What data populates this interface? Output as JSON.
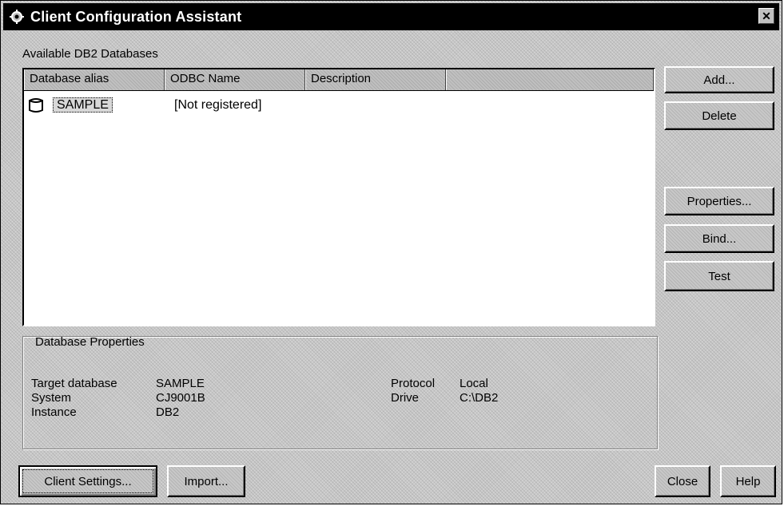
{
  "window": {
    "title": "Client Configuration Assistant",
    "close_glyph": "✕"
  },
  "databases_section": {
    "label": "Available DB2 Databases",
    "columns": [
      "Database alias",
      "ODBC Name",
      "Description",
      ""
    ],
    "rows": [
      {
        "alias": "SAMPLE",
        "odbc_name": "[Not registered]",
        "description": ""
      }
    ]
  },
  "side_buttons": {
    "add": "Add...",
    "delete": "Delete",
    "properties": "Properties...",
    "bind": "Bind...",
    "test": "Test"
  },
  "properties_section": {
    "title": "Database Properties",
    "target_database_label": "Target database",
    "target_database_value": "SAMPLE",
    "system_label": "System",
    "system_value": "CJ9001B",
    "instance_label": "Instance",
    "instance_value": "DB2",
    "protocol_label": "Protocol",
    "protocol_value": "Local",
    "drive_label": "Drive",
    "drive_value": "C:\\DB2"
  },
  "bottom_buttons": {
    "client_settings": "Client Settings...",
    "import": "Import...",
    "close": "Close",
    "help": "Help"
  }
}
